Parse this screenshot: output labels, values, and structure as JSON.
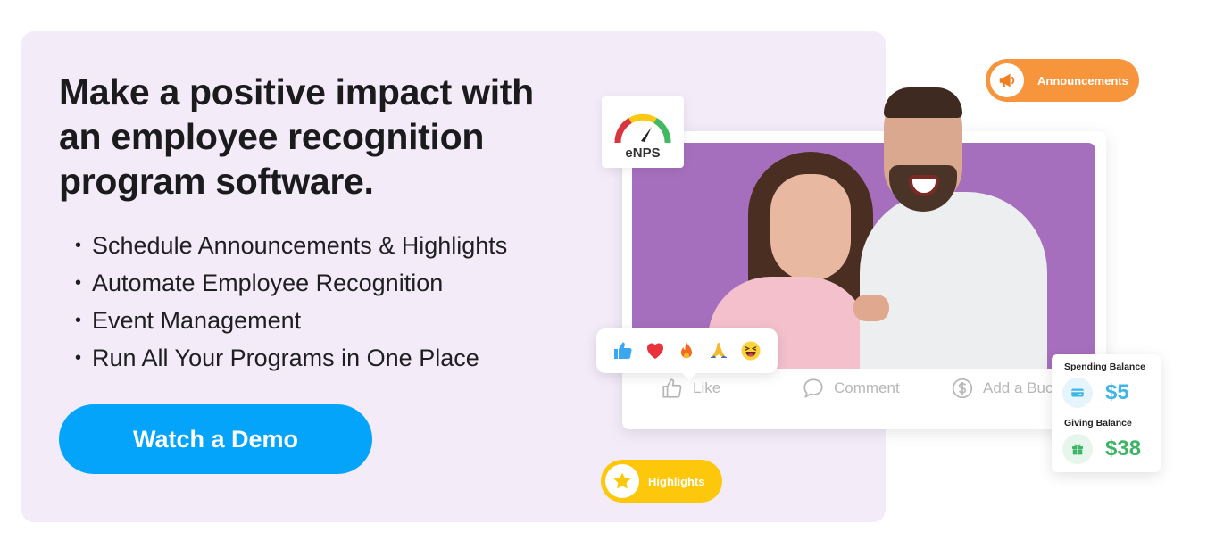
{
  "hero": {
    "headline": "Make a positive impact with an employee recognition program software.",
    "features": [
      "Schedule Announcements & Highlights",
      "Automate Employee Recognition",
      "Event Management",
      "Run All Your Programs in One Place"
    ],
    "bullet": "•",
    "cta_label": "Watch a Demo"
  },
  "widgets": {
    "enps_label": "eNPS",
    "announcements_label": "Announcements",
    "highlights_label": "Highlights",
    "post_actions": {
      "like": "Like",
      "comment": "Comment",
      "add_buck": "Add a Buck"
    },
    "reactions": [
      "thumbs-up",
      "heart",
      "fire",
      "praying-hands",
      "laughing-face"
    ],
    "balance": {
      "spending_title": "Spending Balance",
      "spending_value": "$5",
      "giving_title": "Giving Balance",
      "giving_value": "$38"
    }
  },
  "colors": {
    "panel_bg": "#f3ebf8",
    "cta": "#05a4fb",
    "announcements": "#f7953c",
    "highlights": "#fdc80c",
    "photo_bg": "#a66fbd",
    "spending": "#3fb6e6",
    "giving": "#3cb564"
  }
}
